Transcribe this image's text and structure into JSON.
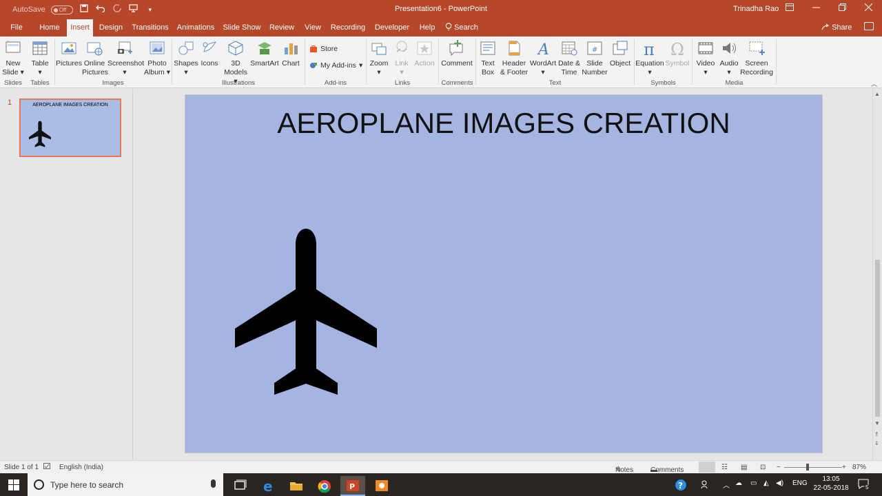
{
  "titlebar": {
    "autosave_label": "AutoSave",
    "autosave_state": "Off",
    "document_title": "Presentation6  -  PowerPoint",
    "user_name": "Trinadha Rao"
  },
  "tabs": {
    "file": "File",
    "home": "Home",
    "insert": "Insert",
    "design": "Design",
    "transitions": "Transitions",
    "animations": "Animations",
    "slideshow": "Slide Show",
    "review": "Review",
    "view": "View",
    "recording": "Recording",
    "developer": "Developer",
    "help": "Help",
    "search": "Search",
    "share": "Share",
    "active": "Insert"
  },
  "ribbon": {
    "new_slide": [
      "New",
      "Slide"
    ],
    "table": "Table",
    "pictures": "Pictures",
    "online_pictures": [
      "Online",
      "Pictures"
    ],
    "screenshot": "Screenshot",
    "photo_album": [
      "Photo",
      "Album"
    ],
    "shapes": "Shapes",
    "icons": "Icons",
    "models_3d": [
      "3D",
      "Models"
    ],
    "smartart": "SmartArt",
    "chart": "Chart",
    "store": "Store",
    "my_addins": "My Add-ins",
    "zoom": "Zoom",
    "link": "Link",
    "action": "Action",
    "comment": "Comment",
    "text_box": [
      "Text",
      "Box"
    ],
    "header_footer": [
      "Header",
      "& Footer"
    ],
    "wordart": "WordArt",
    "date_time": [
      "Date &",
      "Time"
    ],
    "slide_number": [
      "Slide",
      "Number"
    ],
    "object": "Object",
    "equation": "Equation",
    "symbol": "Symbol",
    "video": "Video",
    "audio": "Audio",
    "screen_recording": [
      "Screen",
      "Recording"
    ],
    "groups": {
      "slides": "Slides",
      "tables": "Tables",
      "images": "Images",
      "illustrations": "Illustrations",
      "addins": "Add-ins",
      "links": "Links",
      "comments": "Comments",
      "text": "Text",
      "symbols": "Symbols",
      "media": "Media"
    }
  },
  "thumbnails": [
    {
      "number": "1",
      "title": "AEROPLANE IMAGES CREATION"
    }
  ],
  "slide": {
    "title": "AEROPLANE IMAGES CREATION",
    "image": "airplane-icon",
    "background": "#a3b5e0"
  },
  "statusbar": {
    "slide_info": "Slide 1 of 1",
    "language": "English (India)",
    "notes": "Notes",
    "comments": "Comments",
    "zoom": "87%"
  },
  "taskbar": {
    "search_placeholder": "Type here to search",
    "language": "ENG",
    "time": "13:05",
    "date": "22-05-2018",
    "notification_count": "5"
  },
  "colors": {
    "accent": "#b7472a",
    "ribbon_bg": "#f3f3f3",
    "slide_bg": "#a3b5e0"
  }
}
